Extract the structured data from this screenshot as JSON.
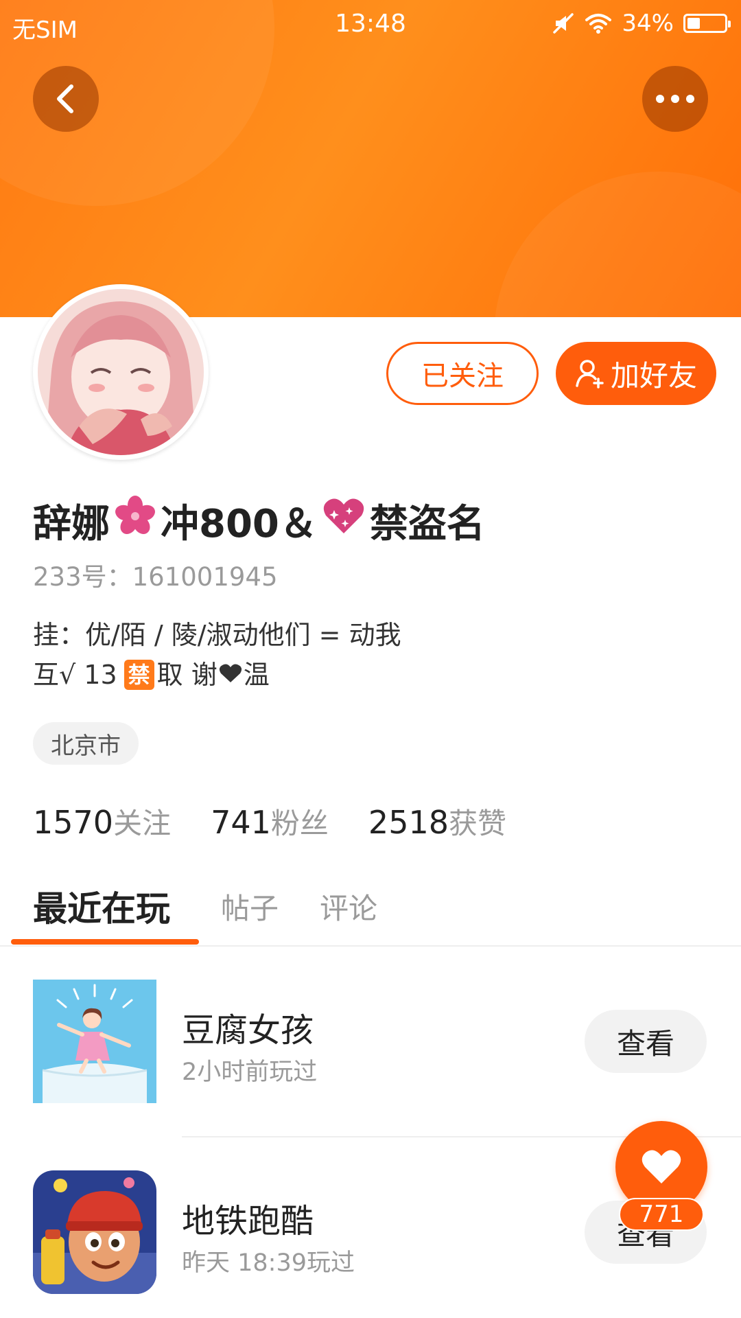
{
  "status_bar": {
    "carrier": "无SIM",
    "time": "13:48",
    "battery_text": "34%",
    "battery_level": 0.34,
    "icons": [
      "mute-icon",
      "wifi-icon",
      "battery-icon"
    ]
  },
  "header": {
    "background_color": "#ff7a12",
    "back_icon": "chevron-left-icon",
    "more_icon": "more-horizontal-icon"
  },
  "profile": {
    "avatar_icon": "anime-girl-avatar",
    "follow_label": "已关注",
    "add_friend_label": "加好友",
    "add_friend_icon": "add-user-icon",
    "nickname_part1": "辞娜",
    "nickname_part2": "冲800＆",
    "nickname_part3": "禁盗名",
    "nickname_emojis": [
      "sakura-flower-icon",
      "sparkling-heart-icon"
    ],
    "user_id": "233号：161001945",
    "bio_line1": "挂：优/陌 / 陵/淑动他们 = 动我",
    "bio_line2_a": "互√ 13",
    "bio_ban_badge": "禁",
    "bio_line2_b": "取 谢",
    "bio_line2_c": "温",
    "location": "北京市"
  },
  "stats": [
    {
      "value": "1570",
      "label": "关注"
    },
    {
      "value": "741",
      "label": "粉丝"
    },
    {
      "value": "2518",
      "label": "获赞"
    }
  ],
  "tabs": [
    {
      "label": "最近在玩",
      "active": true
    },
    {
      "label": "帖子",
      "active": false
    },
    {
      "label": "评论",
      "active": false
    }
  ],
  "games": [
    {
      "name": "豆腐女孩",
      "time": "2小时前玩过",
      "action": "查看",
      "icon": "tofu-girl-game-icon"
    },
    {
      "name": "地铁跑酷",
      "time": "昨天 18:39玩过",
      "action": "查看",
      "icon": "subway-surfers-game-icon"
    }
  ],
  "like_fab": {
    "icon": "heart-icon",
    "count": "771"
  },
  "colors": {
    "accent": "#ff5d0c",
    "header": "#ff7a12",
    "muted_text": "#9a9a9a",
    "pill_background": "#f2f2f2"
  }
}
